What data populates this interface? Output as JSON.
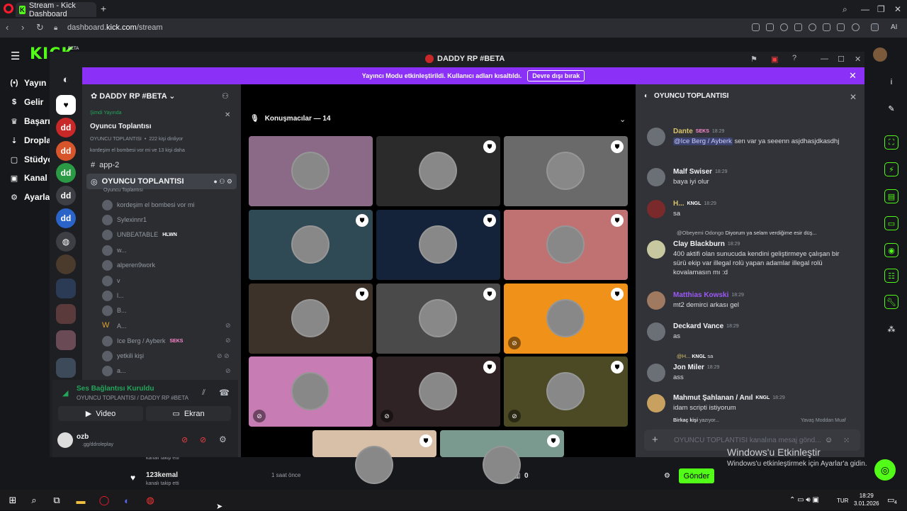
{
  "browser": {
    "tab_title": "Stream - Kick Dashboard",
    "tab_favicon": "K",
    "url_prefix": "dashboard.",
    "url_host": "kick.com",
    "url_path": "/stream"
  },
  "kick": {
    "logo": "KICK",
    "beta": "BETA",
    "nav": [
      "Yayın",
      "Gelir",
      "Başarı",
      "Dropla",
      "Stüdyo",
      "Kanal",
      "Ayarla"
    ],
    "follow_user": "123kemal",
    "follow_time": "1 saat önce",
    "follow_text_1": "kanalı takip etti",
    "follow_text_2": "kanalı takip etti",
    "chat_count": "0",
    "send_label": "Gönder"
  },
  "windows_activation": {
    "title": "Windows'u Etkinleştir",
    "subtitle": "Windows'u etkinleştirmek için Ayarlar'a gidin."
  },
  "discord": {
    "window_title": "DADDY RP #BETA",
    "banner_text": "Yayıncı Modu etkinleştirildi. Kullanıcı adları kısaltıldı.",
    "banner_button": "Devre dışı bırak",
    "server_name": "DADDY RP #BETA",
    "live": {
      "label": "Şimdi Yayında",
      "title": "Oyuncu Toplantısı",
      "channel": "OYUNCU TOPLANTISI",
      "listeners": "222 kişi dinliyor",
      "speakers": "kordeşim el bombesi vor mi ve 13 kişi daha"
    },
    "text_channel": "app-2",
    "stage_channel": "OYUNCU TOPLANTISI",
    "stage_topic": "Oyuncu Toplantısı",
    "vc_users": [
      {
        "name": "kordeşim el bombesi vor mi",
        "tag": ""
      },
      {
        "name": "Sylexinnr1",
        "tag": ""
      },
      {
        "name": "UNBEATABLE",
        "tag": "HLWN"
      },
      {
        "name": "w...",
        "tag": ""
      },
      {
        "name": "alperen9work",
        "tag": ""
      },
      {
        "name": "v",
        "tag": ""
      },
      {
        "name": "l...",
        "tag": ""
      },
      {
        "name": "B...",
        "tag": ""
      },
      {
        "name": "A...",
        "tag": ""
      },
      {
        "name": "Ice Berg / Ayberk",
        "tag": "SEKS"
      },
      {
        "name": "yetkili kişi",
        "tag": ""
      },
      {
        "name": "a...",
        "tag": ""
      }
    ],
    "voice": {
      "status": "Ses Bağlantısı Kuruldu",
      "channel": "OYUNCU TOPLANTISI / DADDY RP #BETA",
      "video": "Video",
      "screen": "Ekran"
    },
    "me": {
      "name": "ozb",
      "status": ".gg/ddroleplay"
    },
    "stage": {
      "speakers_label": "Konuşmacılar — 14",
      "tile_colors": [
        "#8a6a86",
        "#2b2b2b",
        "#6a6a6a",
        "#2f4a55",
        "#14233a",
        "#c07272",
        "#3c322a",
        "#4a4a4a",
        "#f0921a",
        "#c77cb4",
        "#2f2325",
        "#4b4a25",
        "#d8bfa8",
        "#7a9a90"
      ]
    },
    "chat": {
      "channel": "OYUNCU TOPLANTISI",
      "input_placeholder": "OYUNCU TOPLANTISI kanalına mesaj gönd...",
      "messages": [
        {
          "name": "Dante",
          "tag": "SEKS",
          "time": "18:29",
          "mention": "@Ice Berg / Ayberk",
          "text": " sen var ya seeenn asjdhasjdkasdhj",
          "color": "#d9c26a"
        },
        {
          "name": "Malf Swiser",
          "tag": "",
          "time": "18:29",
          "mention": "",
          "text": "baya iyi olur",
          "color": "#f2f3f5"
        },
        {
          "name": "H...",
          "tag": "KNGL",
          "time": "18:29",
          "mention": "",
          "text": "sa",
          "color": "#d9c26a"
        },
        {
          "name": "Clay Blackburn",
          "tag": "",
          "time": "18:29",
          "mention": "",
          "text": "400 aktifi olan sunucuda kendini geliştirmeye çalışan bir sürü ekip var illegal rolü yapan adamlar illegal rolü kovalamasın mı :d",
          "color": "#f2f3f5",
          "reply_user": "@Obeyemi Odongo",
          "reply_text": "Diyorum ya selam verdiğime esir düş..."
        },
        {
          "name": "Matthias Kowski",
          "tag": "",
          "time": "18:29",
          "mention": "",
          "text": "mt2 demirci arkası gel",
          "color": "#9b59f5"
        },
        {
          "name": "Deckard Vance",
          "tag": "",
          "time": "18:29",
          "mention": "",
          "text": "as",
          "color": "#f2f3f5"
        },
        {
          "name": "Jon Miler",
          "tag": "",
          "time": "18:29",
          "mention": "",
          "text": "ass",
          "color": "#f2f3f5",
          "reply_user": "@H...",
          "reply_tag": "KNGL",
          "reply_text": "sa"
        },
        {
          "name": "Mahmut Şahlanan / Anıl",
          "tag": "KNGL",
          "time": "18:29",
          "mention": "",
          "text": "idam scripti istiyorum",
          "color": "#f2f3f5"
        }
      ],
      "typing": "Birkaç kişi",
      "typing_suffix": "yazıyor...",
      "slow_mode": "Yavaş Moddan Muaf"
    }
  },
  "taskbar": {
    "lang": "TUR",
    "time": "18:29",
    "date": "3.01.2026",
    "notif_count": "4"
  },
  "colors": {
    "kick_green": "#53fc18",
    "discord_purple": "#8a30f7",
    "connected_green": "#23a55a"
  }
}
